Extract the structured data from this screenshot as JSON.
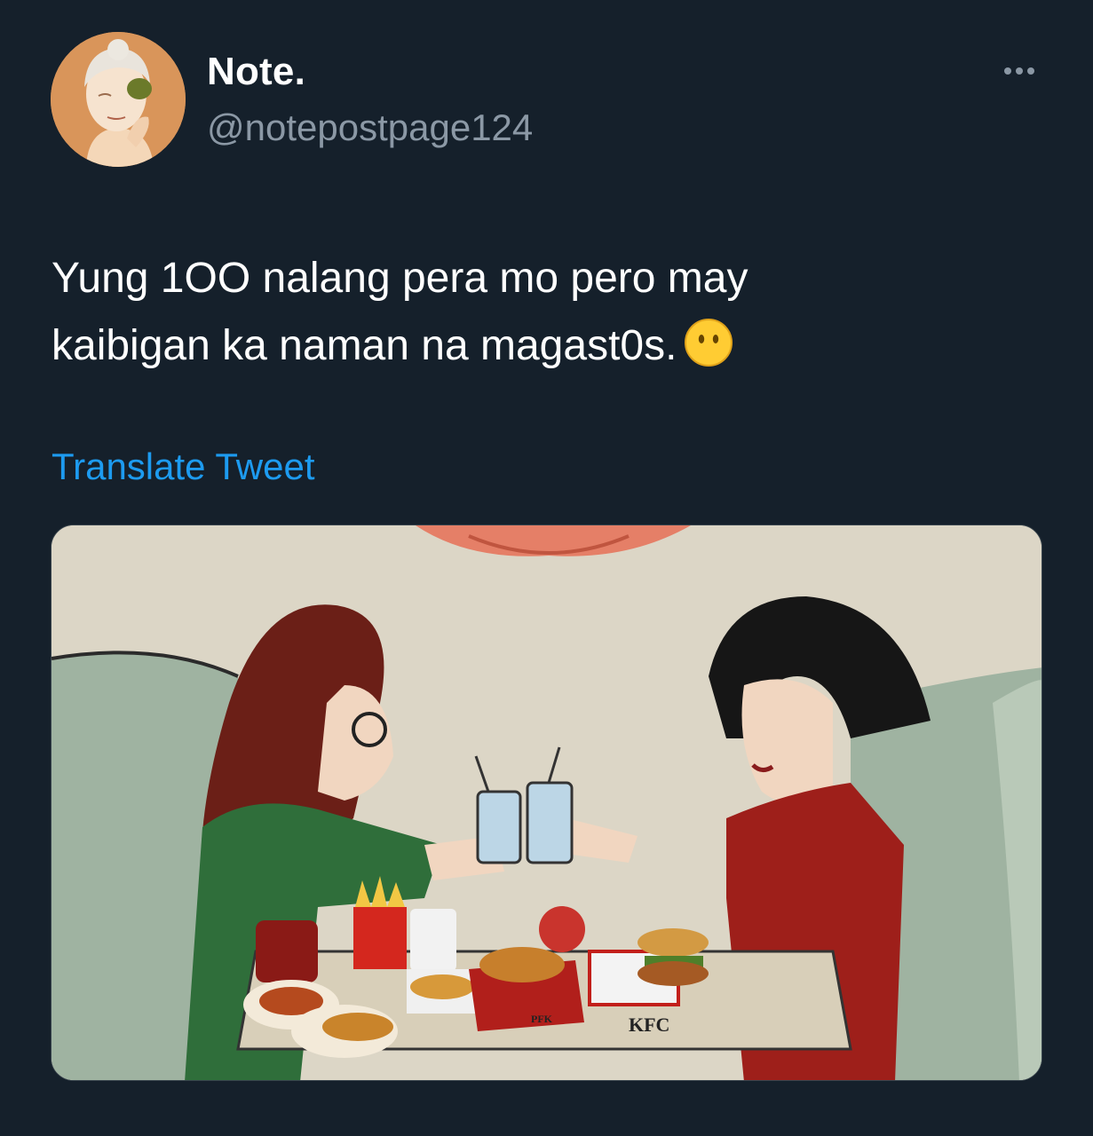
{
  "author": {
    "display_name": "Note.",
    "handle": "@notepostpage124",
    "avatar_icon": "avatar-portrait"
  },
  "tweet": {
    "text": "Yung 1OO nalang pera mo pero may\nkaibigan ka naman na magast0s.",
    "emoji": "face-without-mouth",
    "translate_label": "Translate Tweet"
  },
  "media": {
    "kind": "cartoon-meme",
    "labels": {
      "kfc": "KFC",
      "pfk": "PFK"
    }
  },
  "colors": {
    "background": "#15202b",
    "secondary_text": "#8b98a5",
    "link": "#1d9bf0"
  }
}
